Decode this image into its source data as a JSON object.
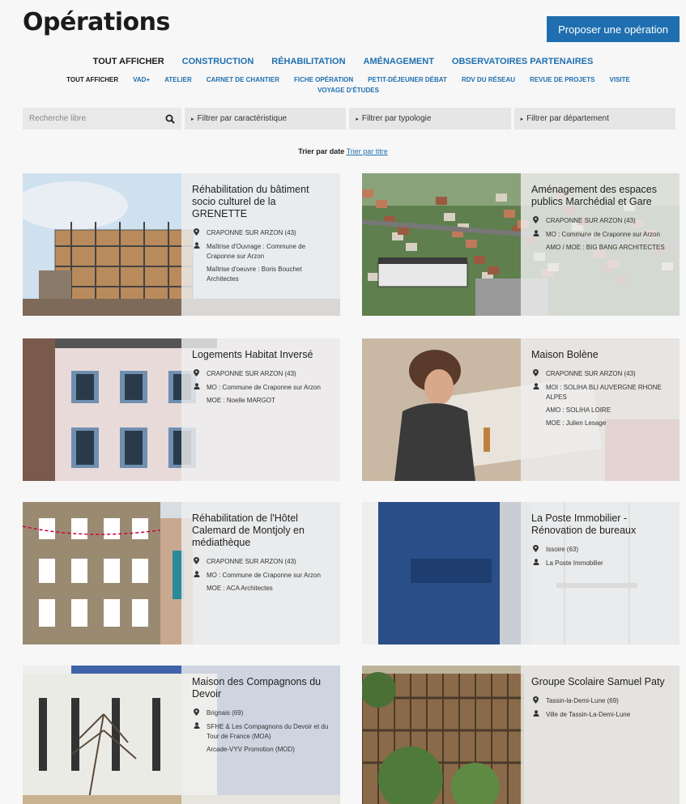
{
  "header": {
    "title": "Opérations",
    "propose_button": "Proposer une opération"
  },
  "nav_primary": [
    {
      "label": "Tout afficher",
      "active": true
    },
    {
      "label": "Construction",
      "active": false
    },
    {
      "label": "Réhabilitation",
      "active": false
    },
    {
      "label": "Aménagement",
      "active": false
    },
    {
      "label": "Observatoires partenaires",
      "active": false
    }
  ],
  "nav_secondary": [
    {
      "label": "Tout afficher",
      "active": true
    },
    {
      "label": "VAD+",
      "active": false
    },
    {
      "label": "Atelier",
      "active": false
    },
    {
      "label": "Carnet de chantier",
      "active": false
    },
    {
      "label": "Fiche opération",
      "active": false
    },
    {
      "label": "Petit-déjeuner débat",
      "active": false
    },
    {
      "label": "RDV du réseau",
      "active": false
    },
    {
      "label": "Revue de projets",
      "active": false
    },
    {
      "label": "Visite",
      "active": false
    },
    {
      "label": "Voyage d'études",
      "active": false
    }
  ],
  "filters": {
    "search_placeholder": "Recherche libre",
    "filter1": "Filtrer par caractéristique",
    "filter2": "Filtrer par typologie",
    "filter3": "Filtrer par département"
  },
  "sort": {
    "current": "Trier par date",
    "alternate": "Trier par titre"
  },
  "colors": {
    "accent": "#1f6fb0",
    "overlay": "#eeeeee"
  },
  "cards": [
    {
      "title": "Réhabilitation du bâtiment socio culturel de la GRENETTE",
      "location": "CRAPONNE SUR ARZON (43)",
      "mo": "Maîtrise d'Ouvrage : Commune de Craponne sur Arzon",
      "extra": [
        "Maîtrise d'oeuvre : Boris Bouchet Architectes"
      ],
      "image": "scaffolding-building"
    },
    {
      "title": "Aménagement des espaces publics Marchédial et Gare",
      "location": "CRAPONNE SUR ARZON (43)",
      "mo": "MO : Commune de Craponne sur Arzon",
      "extra": [
        "AMO / MOE : BIG BANG ARCHITECTES"
      ],
      "image": "aerial-town"
    },
    {
      "title": "Logements Habitat Inversé",
      "location": "CRAPONNE SUR ARZON (43)",
      "mo": "MO : Commune de Craponne sur Arzon",
      "extra": [
        "MOE : Noelle MARGOT"
      ],
      "image": "facade-shutters"
    },
    {
      "title": "Maison Bolène",
      "location": "CRAPONNE SUR ARZON (43)",
      "mo": "MOI : SOLIHA BLI AUVERGNE RHONE ALPES",
      "extra": [
        "AMO : SOLIHA LOIRE",
        "MOE : Julien Lesage"
      ],
      "image": "workshop-woman"
    },
    {
      "title": "Réhabilitation de l'Hôtel Calemard de Montjoly en médiathèque",
      "location": "CRAPONNE SUR ARZON (43)",
      "mo": "MO : Commune de Craponne sur Arzon",
      "extra": [
        "MOE : ACA Architectes"
      ],
      "image": "stone-hotel"
    },
    {
      "title": "La Poste Immobilier - Rénovation de bureaux",
      "location": "Issoire (63)",
      "mo": "La Poste Immobilier",
      "extra": [],
      "image": "bank-office"
    },
    {
      "title": "Maison des Compagnons du Devoir",
      "location": "Brignais (69)",
      "mo": "SFHE & Les Compagnons du Devoir et du Tour de France (MOA)",
      "extra": [
        "Arcade-VYV Promotion (MOD)"
      ],
      "image": "white-building"
    },
    {
      "title": "Groupe Scolaire Samuel Paty",
      "location": "Tassin-la-Demi-Lune (69)",
      "mo": "Ville de Tassin-La-Demi-Lune",
      "extra": [],
      "image": "wooden-school"
    }
  ]
}
